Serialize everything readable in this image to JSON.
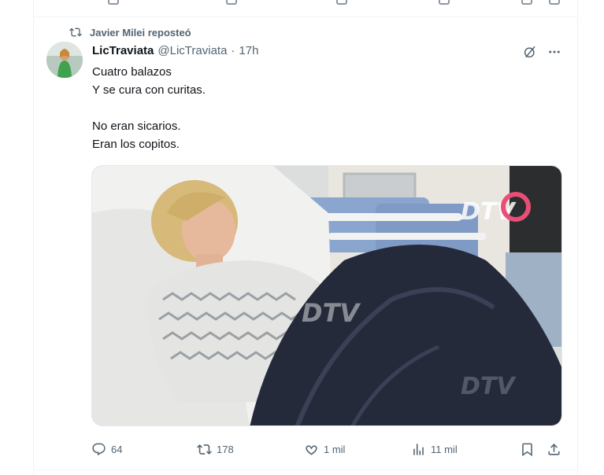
{
  "repost": {
    "label": "Javier Milei reposteó"
  },
  "tweet": {
    "display_name": "LicTraviata",
    "handle": "@LicTraviata",
    "separator": "·",
    "time": "17h",
    "lines": [
      "Cuatro balazos",
      "Y se cura con curitas.",
      "",
      "No eran sicarios.",
      "Eran los copitos."
    ]
  },
  "media": {
    "watermark": "DTV",
    "alt": "Mujer en cama de hospital con bata y manta oscura"
  },
  "actions": {
    "replies": "64",
    "reposts": "178",
    "likes": "1 mil",
    "views": "11 mil"
  },
  "icons": {
    "repost": "repost-icon",
    "reply": "reply-icon",
    "like": "heart-icon",
    "views": "views-icon",
    "bookmark": "bookmark-icon",
    "share": "share-icon",
    "grok": "grok-icon",
    "more": "more-icon"
  },
  "colors": {
    "secondary_text": "#536471",
    "primary_text": "#0f1419",
    "border": "#eff3f4"
  }
}
